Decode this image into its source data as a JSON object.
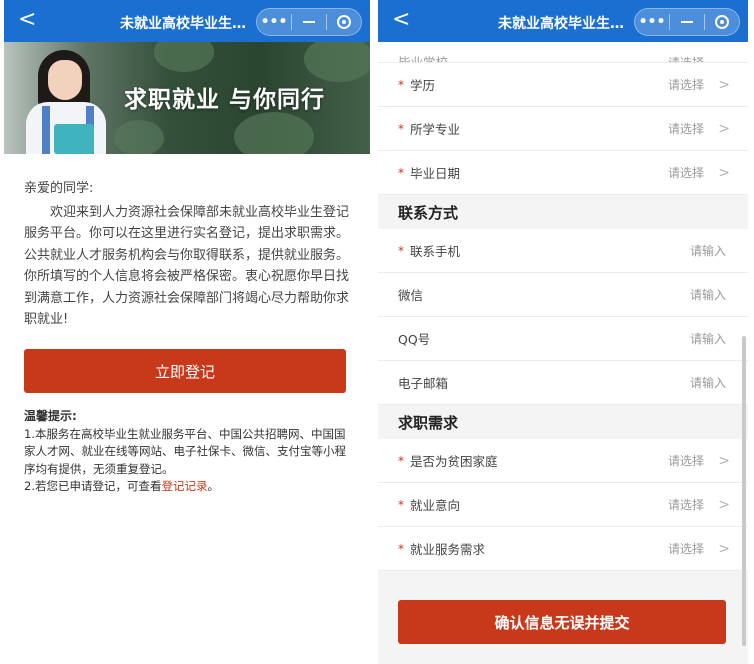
{
  "window": {
    "title": "未就业高校毕业生求...",
    "back_icon": "chevron-left-icon",
    "capsule_icons": [
      "more-icon",
      "minimize-icon",
      "close-target-icon"
    ],
    "more_glyph": "•••",
    "back_glyph": "<"
  },
  "left": {
    "banner": {
      "slogan": "求职就业  与你同行"
    },
    "intro": {
      "greeting": "亲爱的同学:",
      "body": "欢迎来到人力资源社会保障部未就业高校毕业生登记服务平台。你可以在这里进行实名登记，提出求职需求。公共就业人才服务机构会与你取得联系，提供就业服务。你所填写的个人信息将会被严格保密。衷心祝愿你早日找到满意工作，人力资源社会保障部门将竭心尽力帮助你求职就业!"
    },
    "register_button": "立即登记",
    "tips": {
      "title": "温馨提示:",
      "line1": "1.本服务在高校毕业生就业服务平台、中国公共招聘网、中国国家人才网、就业在线等网站、电子社保卡、微信、支付宝等小程序均有提供，无须重复登记。",
      "line2_prefix": "2.若您已申请登记，可查看",
      "line2_link": "登记记录",
      "line2_suffix": "。"
    }
  },
  "right": {
    "partial_row": {
      "label": "毕业学校",
      "placeholder": "请选择"
    },
    "education_rows": [
      {
        "label": "学历",
        "required": true,
        "placeholder": "请选择"
      },
      {
        "label": "所学专业",
        "required": true,
        "placeholder": "请选择"
      },
      {
        "label": "毕业日期",
        "required": true,
        "placeholder": "请选择"
      }
    ],
    "contact_section": "联系方式",
    "contact_rows": [
      {
        "label": "联系手机",
        "required": true,
        "placeholder": "请输入"
      },
      {
        "label": "微信",
        "required": false,
        "placeholder": "请输入"
      },
      {
        "label": "QQ号",
        "required": false,
        "placeholder": "请输入"
      },
      {
        "label": "电子邮箱",
        "required": false,
        "placeholder": "请输入"
      }
    ],
    "demand_section": "求职需求",
    "demand_rows": [
      {
        "label": "是否为贫困家庭",
        "required": true,
        "placeholder": "请选择"
      },
      {
        "label": "就业意向",
        "required": true,
        "placeholder": "请选择"
      },
      {
        "label": "就业服务需求",
        "required": true,
        "placeholder": "请选择"
      }
    ],
    "required_mark": "*",
    "chevron_glyph": ">",
    "submit_button": "确认信息无误并提交"
  },
  "colors": {
    "titlebar": "#1b6fd1",
    "accent": "#c8391c",
    "link": "#c8391c"
  }
}
